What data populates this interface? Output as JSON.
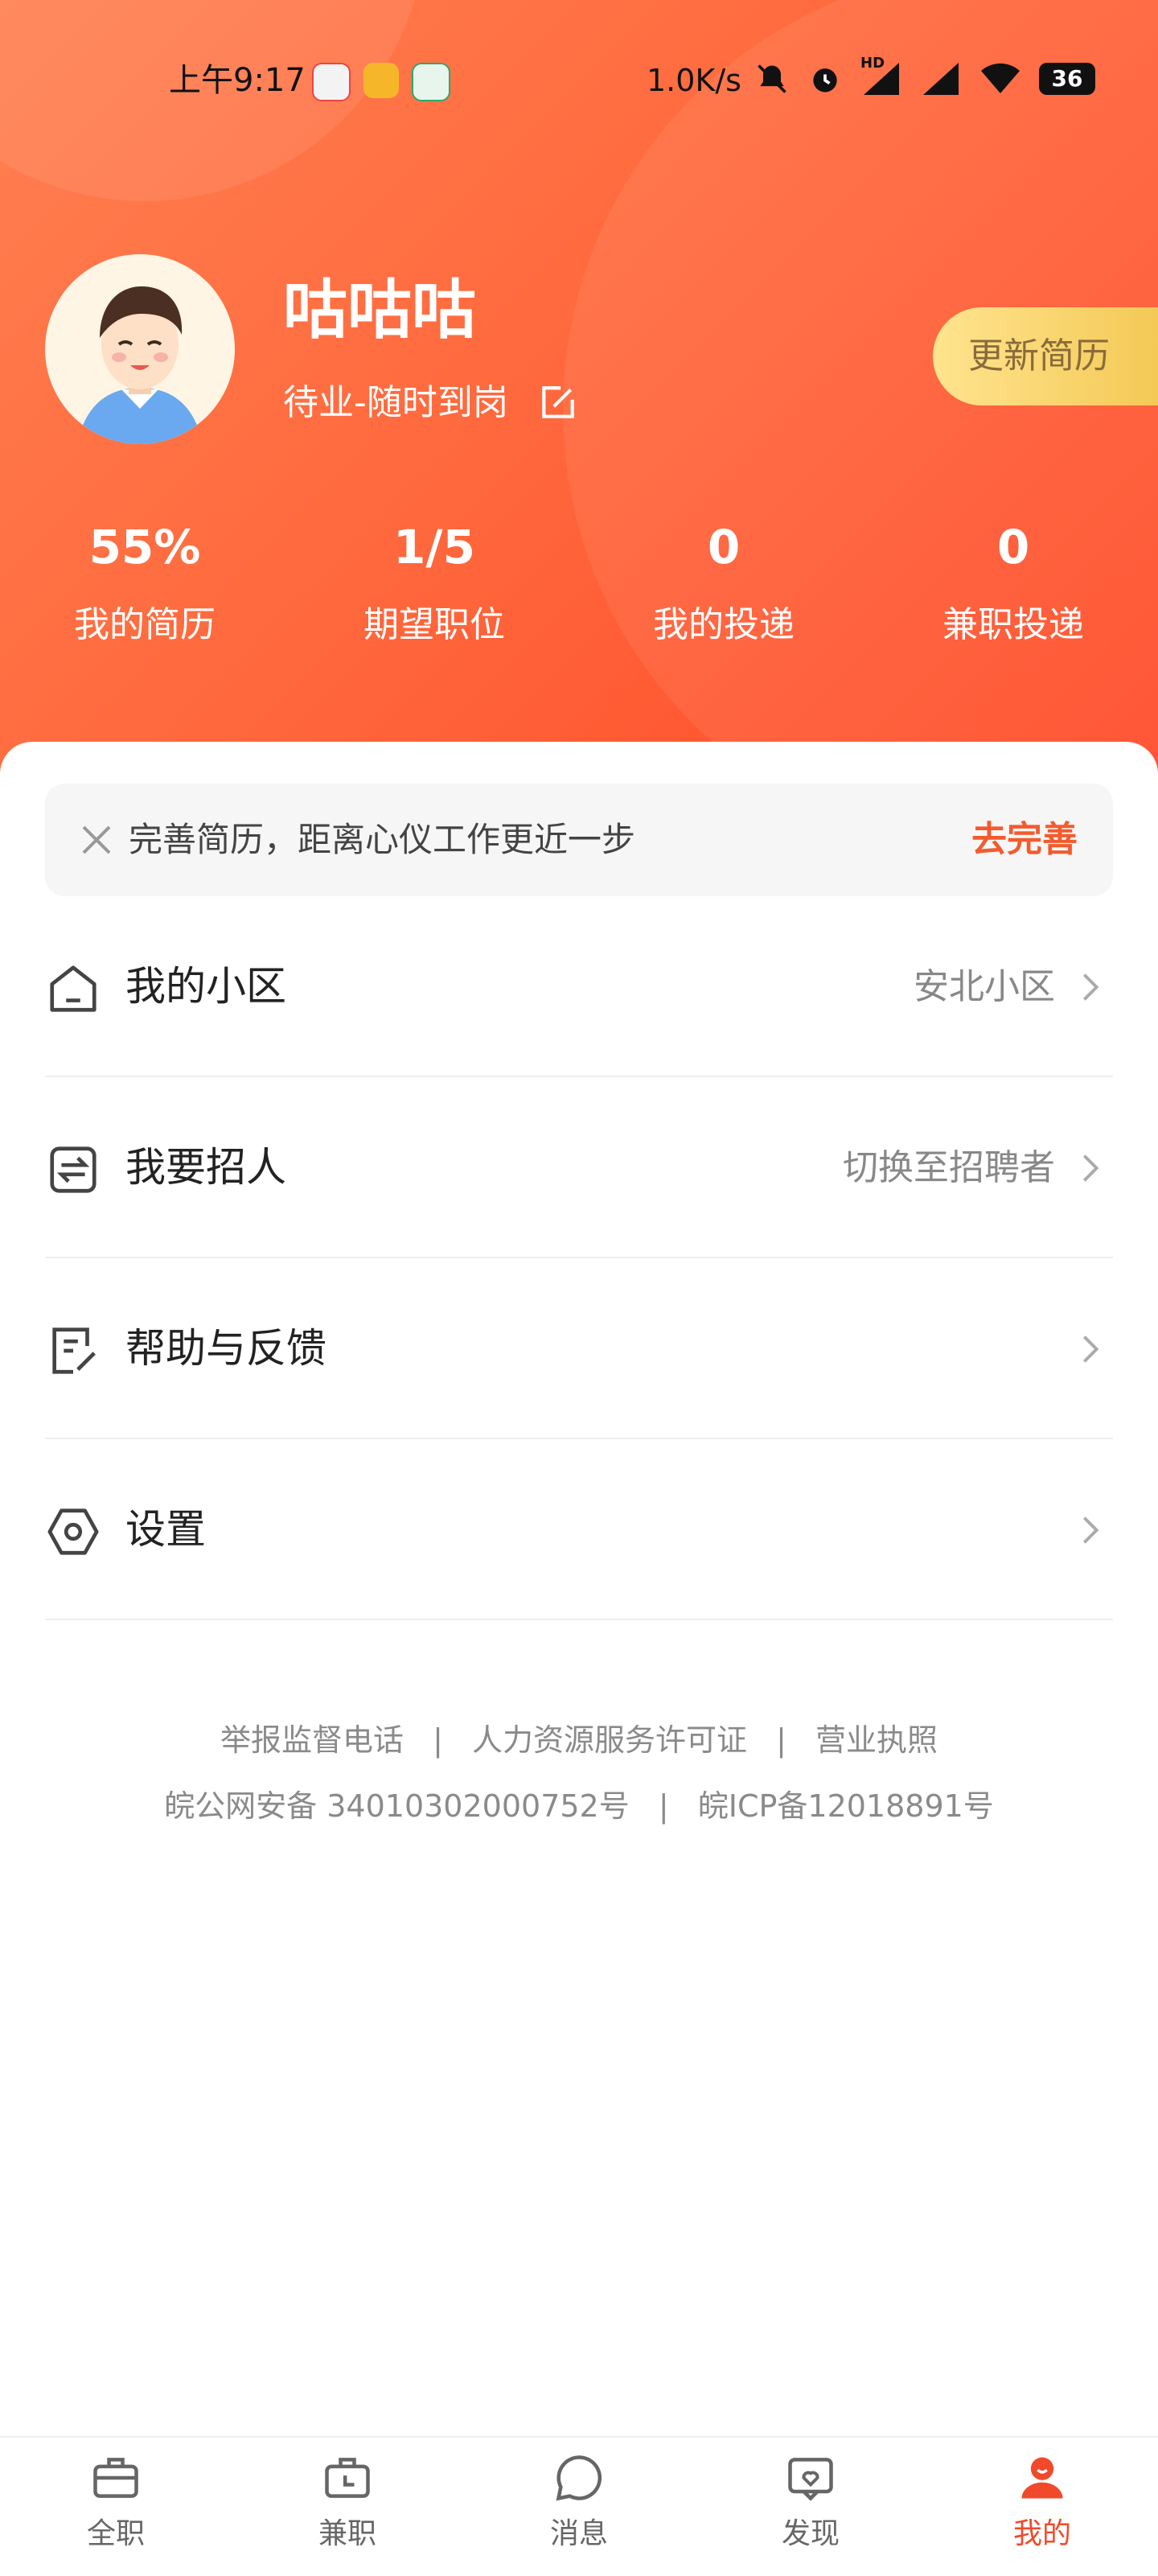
{
  "status_bar": {
    "time": "上午9:17",
    "speed": "1.0K/s",
    "battery": "36",
    "signal_tag": "HD"
  },
  "profile": {
    "name": "咕咕咕",
    "status": "待业-随时到岗",
    "update_button": "更新简历"
  },
  "stats": [
    {
      "value": "55%",
      "label": "我的简历"
    },
    {
      "value": "1/5",
      "label": "期望职位"
    },
    {
      "value": "0",
      "label": "我的投递"
    },
    {
      "value": "0",
      "label": "兼职投递"
    }
  ],
  "tip": {
    "text": "完善简历，距离心仪工作更近一步",
    "action": "去完善"
  },
  "menu": [
    {
      "label": "我的小区",
      "value": "安北小区",
      "icon": "home-icon"
    },
    {
      "label": "我要招人",
      "value": "切换至招聘者",
      "icon": "recruit-icon"
    },
    {
      "label": "帮助与反馈",
      "value": "",
      "icon": "feedback-icon"
    },
    {
      "label": "设置",
      "value": "",
      "icon": "settings-icon"
    }
  ],
  "footer": {
    "link1": "举报监督电话",
    "link2": "人力资源服务许可证",
    "link3": "营业执照",
    "separator": "|",
    "record1": "皖公网安备 34010302000752号",
    "record2": "皖ICP备12018891号"
  },
  "nav": [
    {
      "label": "全职",
      "icon": "briefcase-icon"
    },
    {
      "label": "兼职",
      "icon": "part-time-icon"
    },
    {
      "label": "消息",
      "icon": "message-icon"
    },
    {
      "label": "发现",
      "icon": "discover-icon"
    },
    {
      "label": "我的",
      "icon": "profile-icon",
      "active": true
    }
  ],
  "colors": {
    "accent": "#f04a2a",
    "header_start": "#ff8051",
    "header_end": "#ff4a28",
    "update_button": "#f3c752"
  }
}
